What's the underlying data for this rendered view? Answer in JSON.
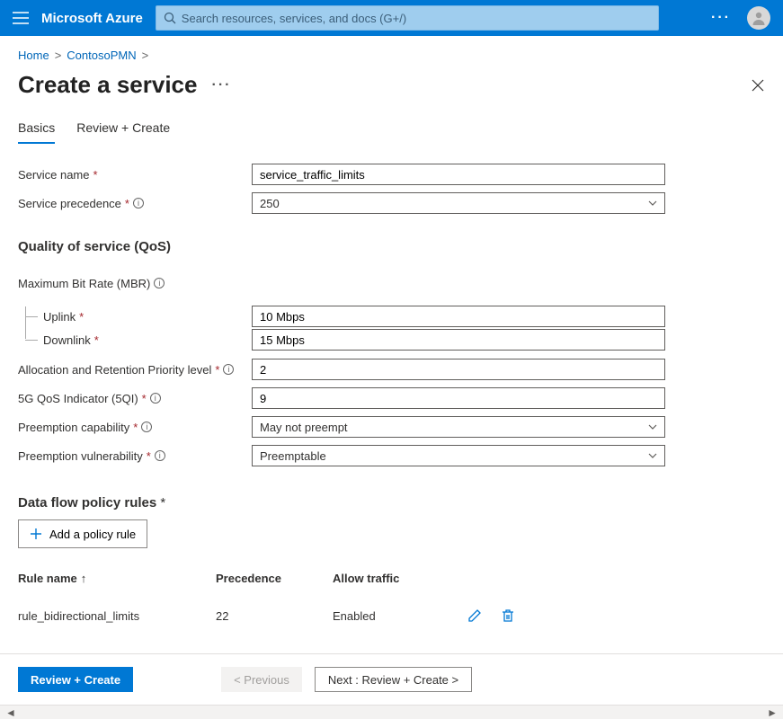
{
  "header": {
    "brand": "Microsoft Azure",
    "search_placeholder": "Search resources, services, and docs (G+/)"
  },
  "breadcrumb": {
    "items": [
      "Home",
      "ContosoPMN"
    ]
  },
  "page": {
    "title": "Create a service"
  },
  "tabs": [
    {
      "label": "Basics",
      "active": true
    },
    {
      "label": "Review + Create",
      "active": false
    }
  ],
  "form": {
    "service_name_label": "Service name",
    "service_name_value": "service_traffic_limits",
    "service_precedence_label": "Service precedence",
    "service_precedence_value": "250",
    "qos_heading": "Quality of service (QoS)",
    "mbr_label": "Maximum Bit Rate (MBR)",
    "uplink_label": "Uplink",
    "uplink_value": "10 Mbps",
    "downlink_label": "Downlink",
    "downlink_value": "15 Mbps",
    "arp_label": "Allocation and Retention Priority level",
    "arp_value": "2",
    "fiveqi_label": "5G QoS Indicator (5QI)",
    "fiveqi_value": "9",
    "preempt_cap_label": "Preemption capability",
    "preempt_cap_value": "May not preempt",
    "preempt_vul_label": "Preemption vulnerability",
    "preempt_vul_value": "Preemptable",
    "rules_heading": "Data flow policy rules",
    "add_rule_label": "Add a policy rule"
  },
  "table": {
    "headers": {
      "name": "Rule name",
      "precedence": "Precedence",
      "allow": "Allow traffic"
    },
    "sort_indicator": "↑",
    "rows": [
      {
        "name": "rule_bidirectional_limits",
        "precedence": "22",
        "allow": "Enabled"
      }
    ]
  },
  "footer": {
    "review": "Review + Create",
    "previous": "< Previous",
    "next": "Next : Review + Create >"
  }
}
